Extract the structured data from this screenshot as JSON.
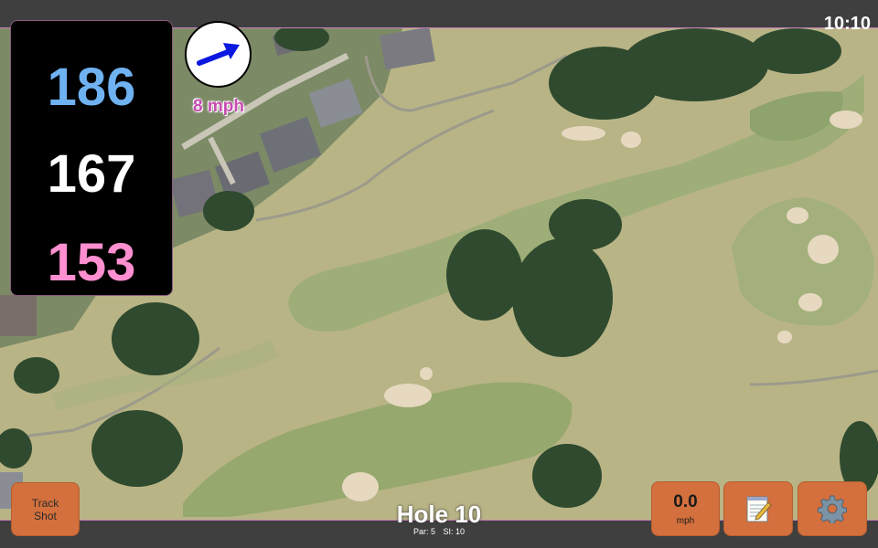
{
  "status": {
    "clock": "10:10"
  },
  "distances": {
    "back": "186",
    "middle": "167",
    "front": "153"
  },
  "wind": {
    "speed_label": "8 mph",
    "direction_icon": "wind-arrow-icon"
  },
  "hole": {
    "title": "Hole 10",
    "par_label": "Par: 5",
    "si_label": "SI: 10"
  },
  "buttons": {
    "track_shot_label": "Track\nShot",
    "speed_value": "0.0",
    "speed_unit": "mph",
    "notes_icon": "notepad-icon",
    "settings_icon": "gear-icon"
  },
  "colors": {
    "back_distance": "#6fb2f2",
    "middle_distance": "#ffffff",
    "front_distance": "#ff8fd0",
    "button_orange": "#d3703d",
    "wind_text": "#c74bb0"
  }
}
